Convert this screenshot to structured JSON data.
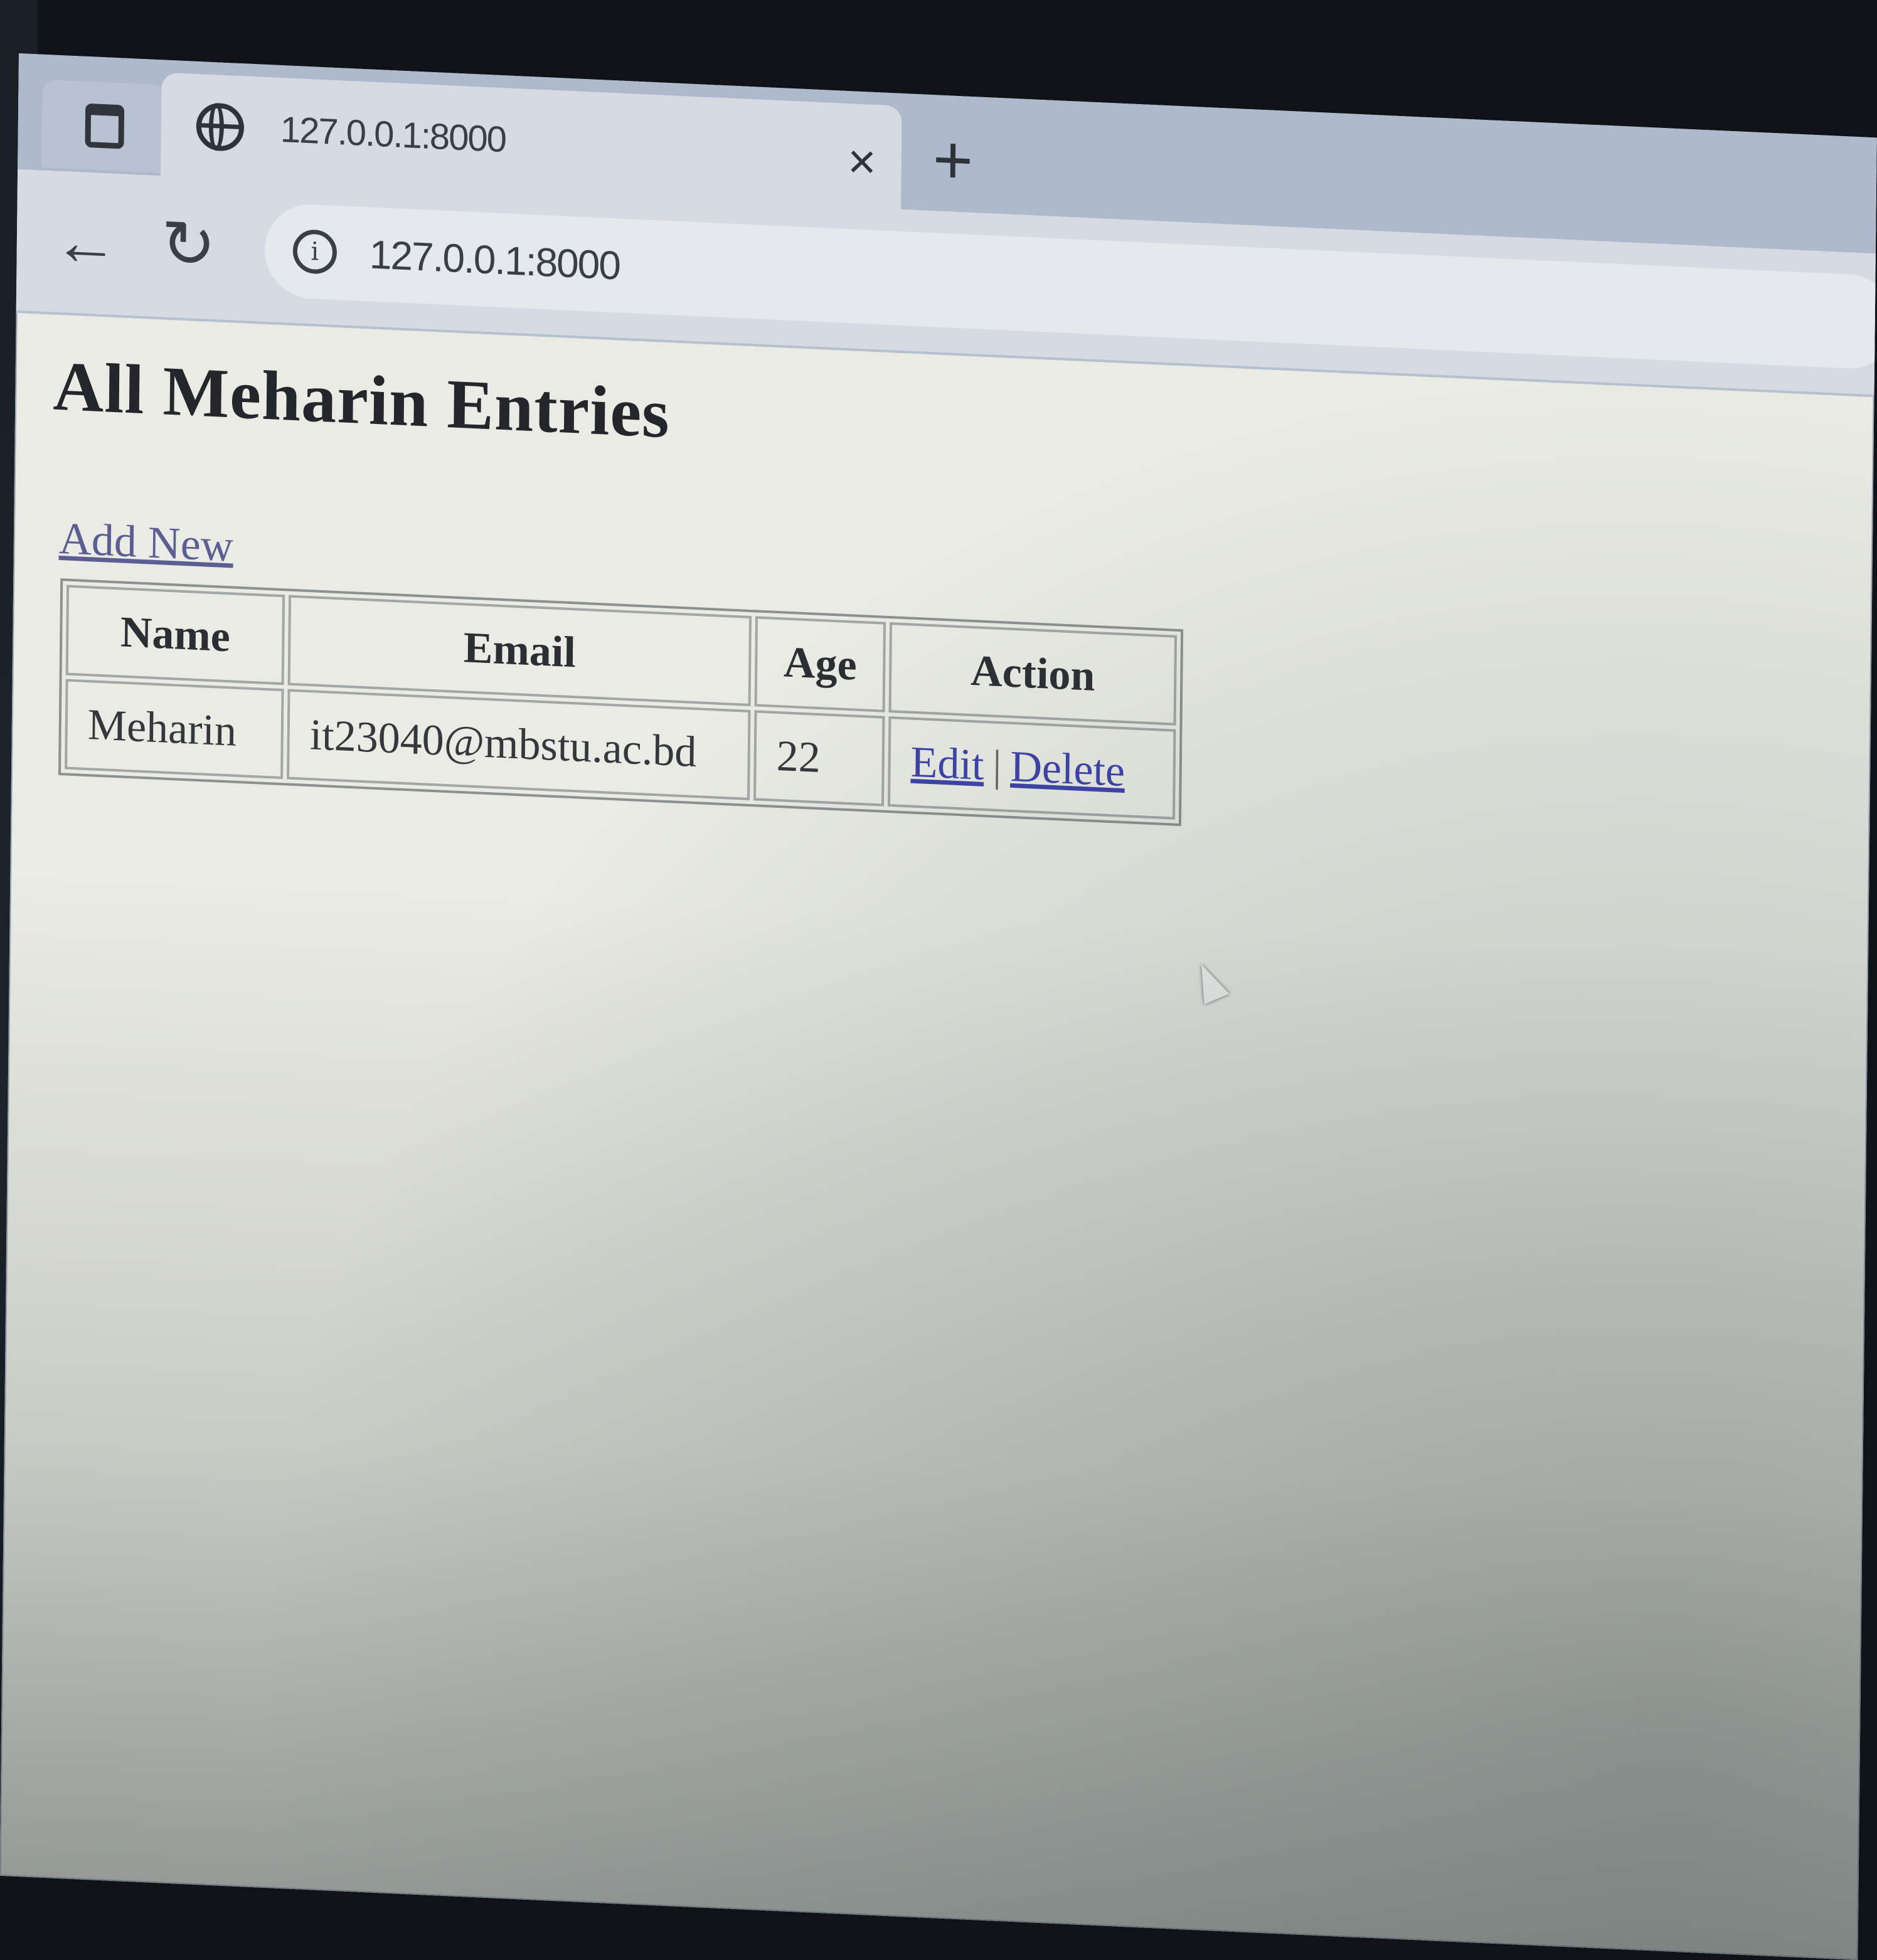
{
  "browser": {
    "tab_title": "127.0.0.1:8000",
    "close_glyph": "×",
    "new_tab_glyph": "+",
    "back_glyph": "←",
    "reload_glyph": "↻",
    "info_glyph": "i",
    "url": "127.0.0.1:8000"
  },
  "page": {
    "title": "All Meharin Entries",
    "add_new_label": "Add New",
    "table": {
      "headers": [
        "Name",
        "Email",
        "Age",
        "Action"
      ],
      "rows": [
        {
          "name": "Meharin",
          "email": "it23040@mbstu.ac.bd",
          "age": "22",
          "edit_label": "Edit",
          "separator": "|",
          "delete_label": "Delete"
        }
      ]
    }
  },
  "colors": {
    "link": "#3d43a8",
    "visited_link": "#5a5e92"
  }
}
